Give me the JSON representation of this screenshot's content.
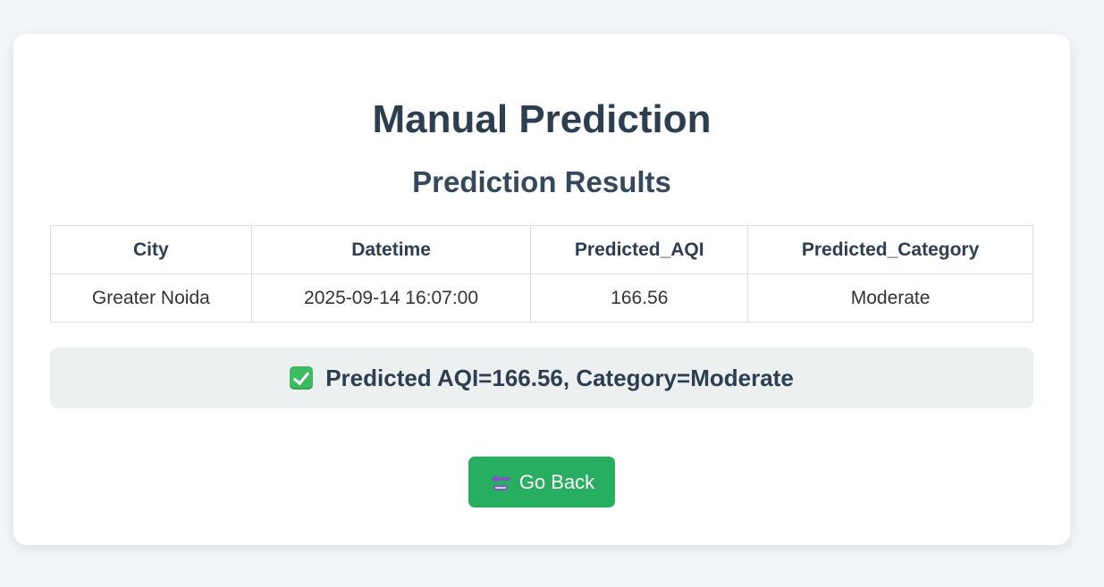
{
  "page": {
    "title": "Manual Prediction",
    "section_title": "Prediction Results"
  },
  "results_table": {
    "headers": [
      "City",
      "Datetime",
      "Predicted_AQI",
      "Predicted_Category"
    ],
    "rows": [
      [
        "Greater Noida",
        "2025-09-14 16:07:00",
        "166.56",
        "Moderate"
      ]
    ]
  },
  "result_banner": {
    "icon": "check-mark-icon",
    "text": "Predicted AQI=166.56, Category=Moderate"
  },
  "back_button": {
    "icon": "back-arrow-icon",
    "label": "Go Back"
  },
  "colors": {
    "page_background": "#f3f6f9",
    "card_background": "#ffffff",
    "title": "#2c3e50",
    "banner_background": "#ecf0f1",
    "button_background": "#27ae60",
    "check_icon": "#3dbb61",
    "back_icon": "#7e57c2"
  }
}
